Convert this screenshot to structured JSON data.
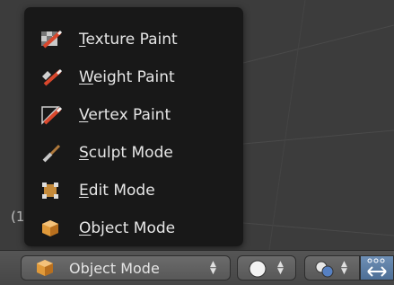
{
  "viewport": {
    "frame_indicator": "(1"
  },
  "menu": {
    "items": [
      {
        "id": "texture-paint",
        "accel": "T",
        "rest": "exture Paint",
        "icon": "texture-paint-icon"
      },
      {
        "id": "weight-paint",
        "accel": "W",
        "rest": "eight Paint",
        "icon": "weight-paint-icon"
      },
      {
        "id": "vertex-paint",
        "accel": "V",
        "rest": "ertex Paint",
        "icon": "vertex-paint-icon"
      },
      {
        "id": "sculpt-mode",
        "accel": "S",
        "rest": "culpt Mode",
        "icon": "sculpt-mode-icon"
      },
      {
        "id": "edit-mode",
        "accel": "E",
        "rest": "dit Mode",
        "icon": "edit-mode-icon"
      },
      {
        "id": "object-mode",
        "accel": "O",
        "rest": "bject Mode",
        "icon": "object-mode-icon"
      }
    ]
  },
  "header": {
    "mode_select": {
      "value": "Object Mode",
      "icon": "object-mode-icon"
    },
    "shading_select": {
      "icon": "solid-sphere-icon"
    },
    "pivot_select": {
      "icon": "pivot-icon"
    },
    "manipulator": {
      "icon": "manipulator-icon"
    }
  },
  "colors": {
    "menu_bg": "#161616",
    "header_bg": "#4e4e4e",
    "accent_blue": "#5680c2"
  }
}
